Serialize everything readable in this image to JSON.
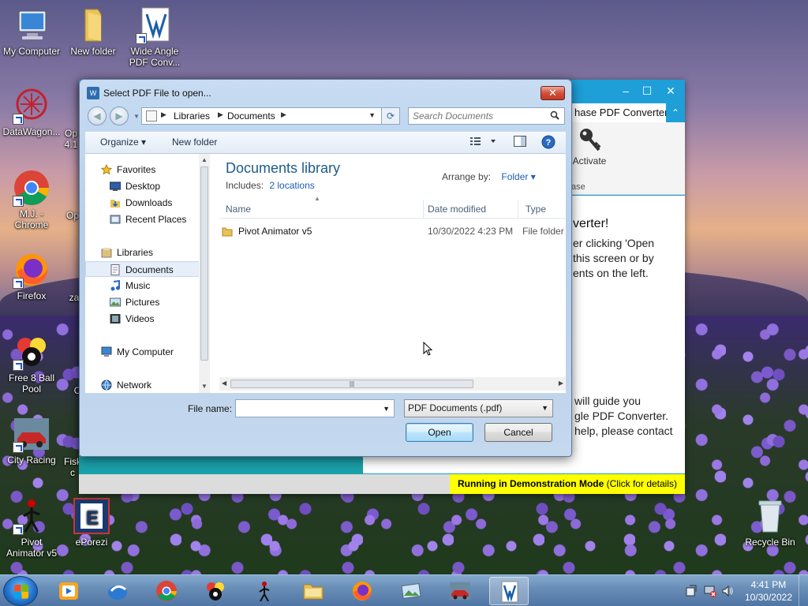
{
  "desktop": {
    "icons": [
      {
        "label": "My Computer"
      },
      {
        "label": "New folder"
      },
      {
        "label": "Wide Angle\nPDF Conv..."
      },
      {
        "label": "DataWagon..."
      },
      {
        "label": "Op\n4.1"
      },
      {
        "label": "M.J. -\nChrome"
      },
      {
        "label": "Op"
      },
      {
        "label": "Firefox"
      },
      {
        "label": "za"
      },
      {
        "label": "Free 8 Ball\nPool"
      },
      {
        "label": "C"
      },
      {
        "label": "City Racing"
      },
      {
        "label": "Fisk\nc"
      },
      {
        "label": "Pivot\nAnimator v5"
      },
      {
        "label": "ePorezi"
      },
      {
        "label": "Recycle Bin"
      }
    ]
  },
  "app_window": {
    "ribbon_title": "hase PDF Converter",
    "activate_label": "Activate",
    "ribbon_group_label": "ase",
    "welcome_title": "verter!",
    "welcome_text": "er clicking 'Open\nthis screen or by\nents on the left.",
    "guide_text": "will guide you\ngle PDF Converter.\nhelp, please contact",
    "demo_bold": "Running in Demonstration Mode",
    "demo_rest": " (Click for details)"
  },
  "dialog": {
    "title": "Select PDF File to open...",
    "close_label": "✕",
    "breadcrumb": [
      "Libraries",
      "Documents"
    ],
    "search_placeholder": "Search Documents",
    "toolbar": {
      "organize": "Organize ▾",
      "new_folder": "New folder"
    },
    "nav": {
      "favorites": "Favorites",
      "desktop": "Desktop",
      "downloads": "Downloads",
      "recent": "Recent Places",
      "libraries": "Libraries",
      "documents": "Documents",
      "music": "Music",
      "pictures": "Pictures",
      "videos": "Videos",
      "computer": "My Computer",
      "network": "Network"
    },
    "library": {
      "title": "Documents library",
      "includes_label": "Includes:",
      "includes_link": "2 locations",
      "arrange_label": "Arrange by:",
      "arrange_value": "Folder ▾"
    },
    "columns": {
      "name": "Name",
      "date": "Date modified",
      "type": "Type"
    },
    "files": [
      {
        "name": "Pivot Animator v5",
        "date": "10/30/2022 4:23 PM",
        "type": "File folder"
      }
    ],
    "file_name_label": "File name:",
    "file_name_value": "",
    "file_type_value": "PDF Documents (.pdf)",
    "open_label": "Open",
    "cancel_label": "Cancel"
  },
  "taskbar": {
    "time": "4:41 PM",
    "date": "10/30/2022"
  }
}
